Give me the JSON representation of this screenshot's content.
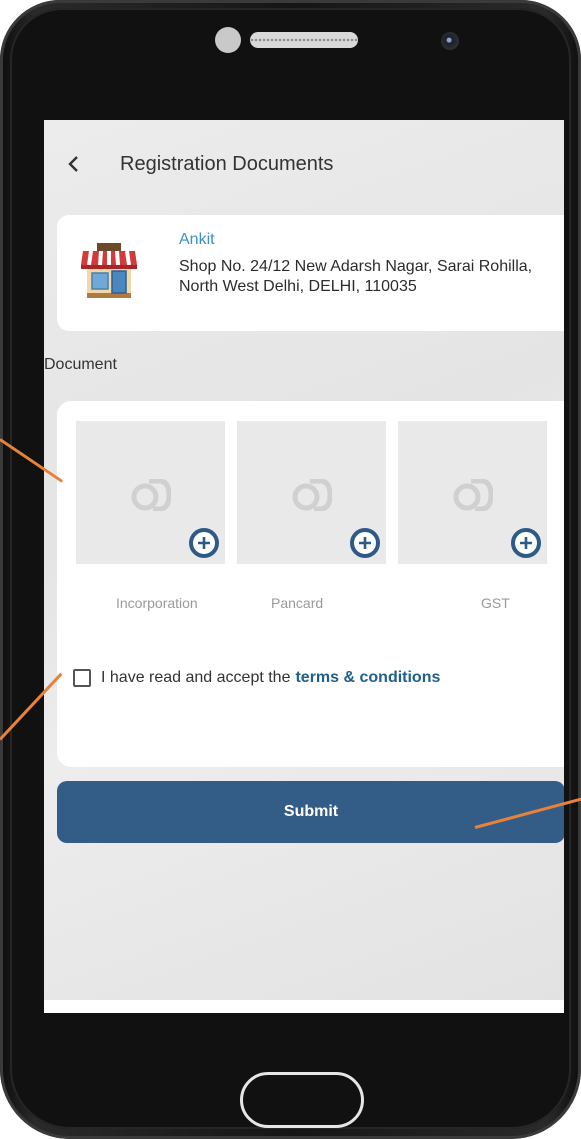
{
  "header": {
    "back_icon": "chevron-left-icon",
    "title": "Registration Documents"
  },
  "shop": {
    "icon": "storefront-icon",
    "name": "Ankit",
    "address": "Shop No. 24/12 New Adarsh Nagar, Sarai Rohilla, North West Delhi, DELHI, 110035"
  },
  "documents": {
    "section_label": "Document",
    "items": [
      {
        "label": "Incorporation",
        "add_icon": "plus-circle-icon"
      },
      {
        "label": "Pancard",
        "add_icon": "plus-circle-icon"
      },
      {
        "label": "GST",
        "add_icon": "plus-circle-icon"
      }
    ]
  },
  "terms": {
    "checked": false,
    "text": "I have read and accept the",
    "link": "terms & conditions"
  },
  "submit_label": "Submit",
  "colors": {
    "accent": "#335d86",
    "link": "#1f5f8b",
    "shop_name": "#3d8fc7",
    "callout": "#e8823a"
  }
}
